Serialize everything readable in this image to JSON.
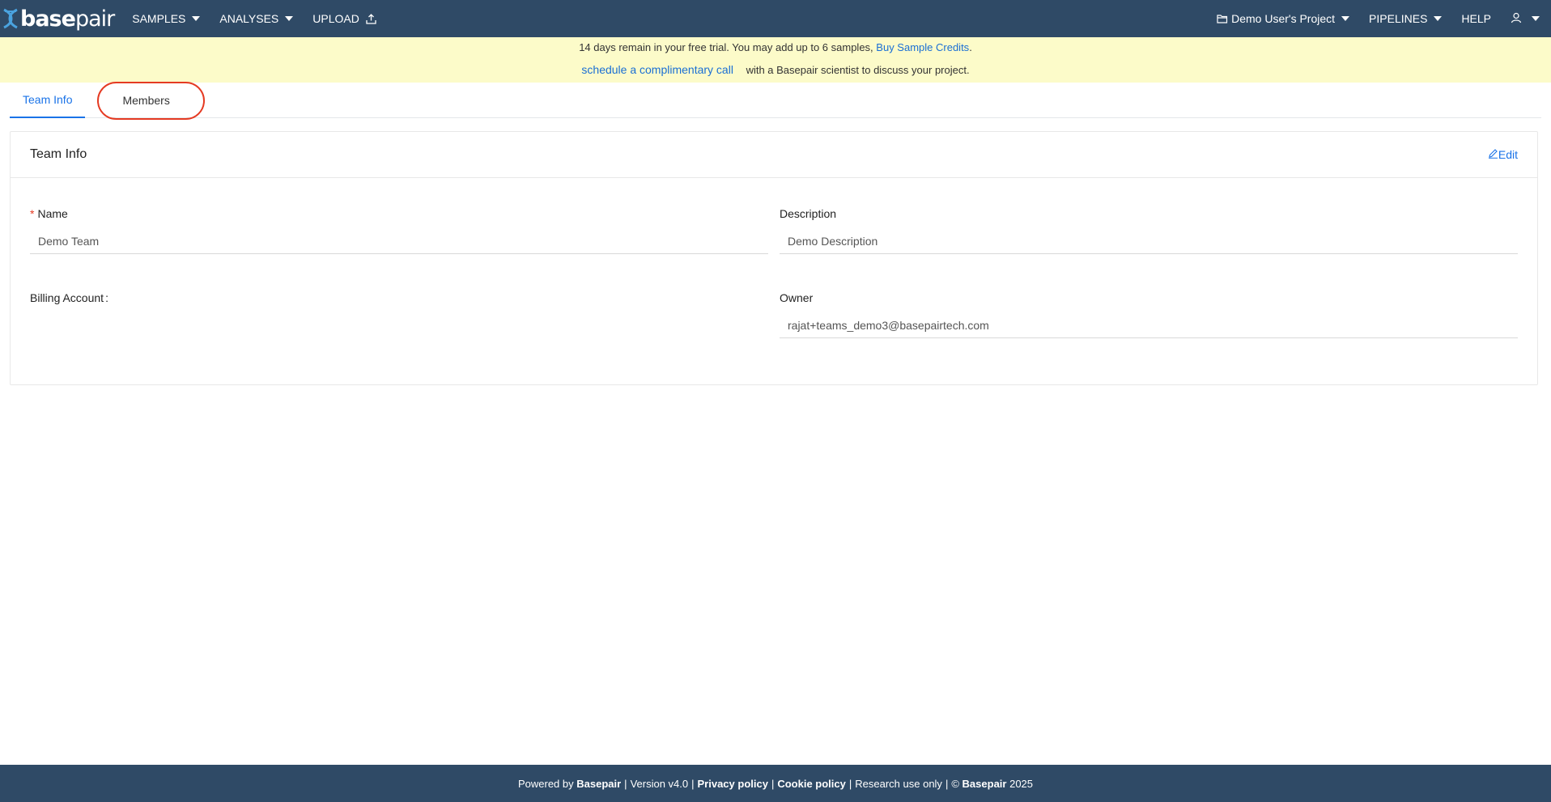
{
  "brand": {
    "name_bold": "base",
    "name_light": "pair"
  },
  "nav": {
    "samples": "SAMPLES",
    "analyses": "ANALYSES",
    "upload": "UPLOAD",
    "project": "Demo User's Project",
    "pipelines": "PIPELINES",
    "help": "HELP"
  },
  "banner": {
    "line1_text": "14 days remain in your free trial. You may add up to 6 samples,",
    "line1_link": "Buy Sample Credits",
    "line1_end": ".",
    "call_link": "schedule a complimentary call",
    "line2_text": "with a Basepair scientist to discuss your project."
  },
  "tabs": {
    "team_info": "Team Info",
    "members": "Members"
  },
  "card": {
    "title": "Team Info",
    "edit": "Edit",
    "name_label": "Name",
    "name_required": "*",
    "name_value": "Demo Team",
    "description_label": "Description",
    "description_value": "Demo Description",
    "billing_label": "Billing Account",
    "billing_colon": ":",
    "owner_label": "Owner",
    "owner_value": "rajat+teams_demo3@basepairtech.com"
  },
  "footer": {
    "powered_by": "Powered by",
    "brand": "Basepair",
    "version": "Version v4.0",
    "privacy": "Privacy policy",
    "cookie": "Cookie policy",
    "research": "Research use only",
    "copyright_symbol": "©",
    "copyright_brand": "Basepair",
    "year": "2025",
    "separator": "|"
  },
  "colors": {
    "navbar": "#2f4a66",
    "banner": "#fcfbc9",
    "accent": "#1a73e8",
    "highlight": "#e53a22"
  }
}
